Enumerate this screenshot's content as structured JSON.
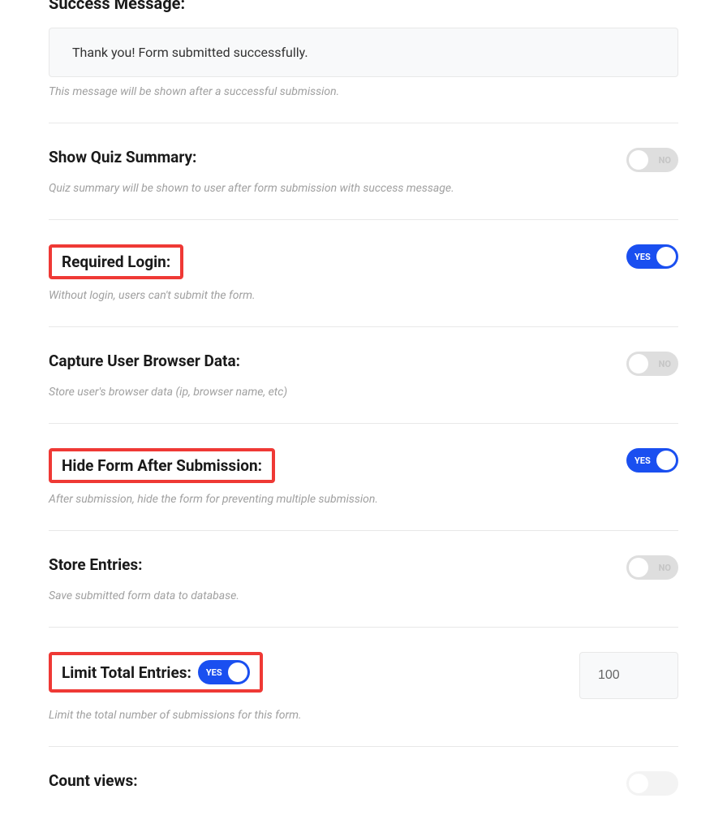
{
  "successMessage": {
    "title": "Success Message:",
    "value": "Thank you! Form submitted successfully.",
    "helper": "This message will be shown after a successful submission."
  },
  "showQuizSummary": {
    "label": "Show Quiz Summary:",
    "helper": "Quiz summary will be shown to user after form submission with success message.",
    "toggleText": "NO"
  },
  "requiredLogin": {
    "label": "Required Login:",
    "helper": "Without login, users can't submit the form.",
    "toggleText": "YES"
  },
  "captureBrowserData": {
    "label": "Capture User Browser Data:",
    "helper": "Store user's browser data (ip, browser name, etc)",
    "toggleText": "NO"
  },
  "hideFormAfterSubmission": {
    "label": "Hide Form After Submission:",
    "helper": "After submission, hide the form for preventing multiple submission.",
    "toggleText": "YES"
  },
  "storeEntries": {
    "label": "Store Entries:",
    "helper": "Save submitted form data to database.",
    "toggleText": "NO"
  },
  "limitTotalEntries": {
    "label": "Limit Total Entries:",
    "helper": "Limit the total number of submissions for this form.",
    "toggleText": "YES",
    "value": "100"
  },
  "countViews": {
    "label": "Count views:"
  }
}
